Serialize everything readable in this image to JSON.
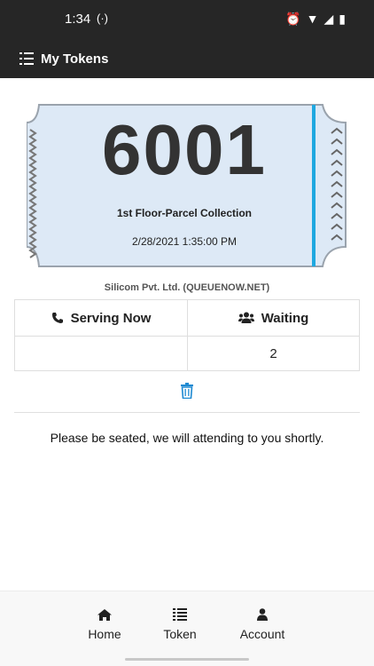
{
  "status_bar": {
    "time": "1:34",
    "icons": [
      "cast-icon",
      "alarm-icon",
      "wifi-icon",
      "signal-icon",
      "battery-icon"
    ]
  },
  "app_bar": {
    "title": "My Tokens",
    "icon": "list-menu-icon"
  },
  "token": {
    "number": "6001",
    "service": "1st Floor-Parcel Collection",
    "datetime": "2/28/2021 1:35:00 PM",
    "ticket_color": "#dde9f6",
    "accent_color": "#1fa8e0"
  },
  "company": "Silicom Pvt. Ltd. (QUEUENOW.NET)",
  "status_table": {
    "headers": [
      {
        "label": "Serving Now",
        "icon": "phone-icon"
      },
      {
        "label": "Waiting",
        "icon": "users-icon"
      }
    ],
    "values": [
      "",
      "2"
    ]
  },
  "delete_icon_color": "#1f8ad2",
  "message": "Please be seated, we will attending to you shortly.",
  "bottom_nav": [
    {
      "label": "Home",
      "icon": "home-icon"
    },
    {
      "label": "Token",
      "icon": "list-icon"
    },
    {
      "label": "Account",
      "icon": "user-icon"
    }
  ]
}
